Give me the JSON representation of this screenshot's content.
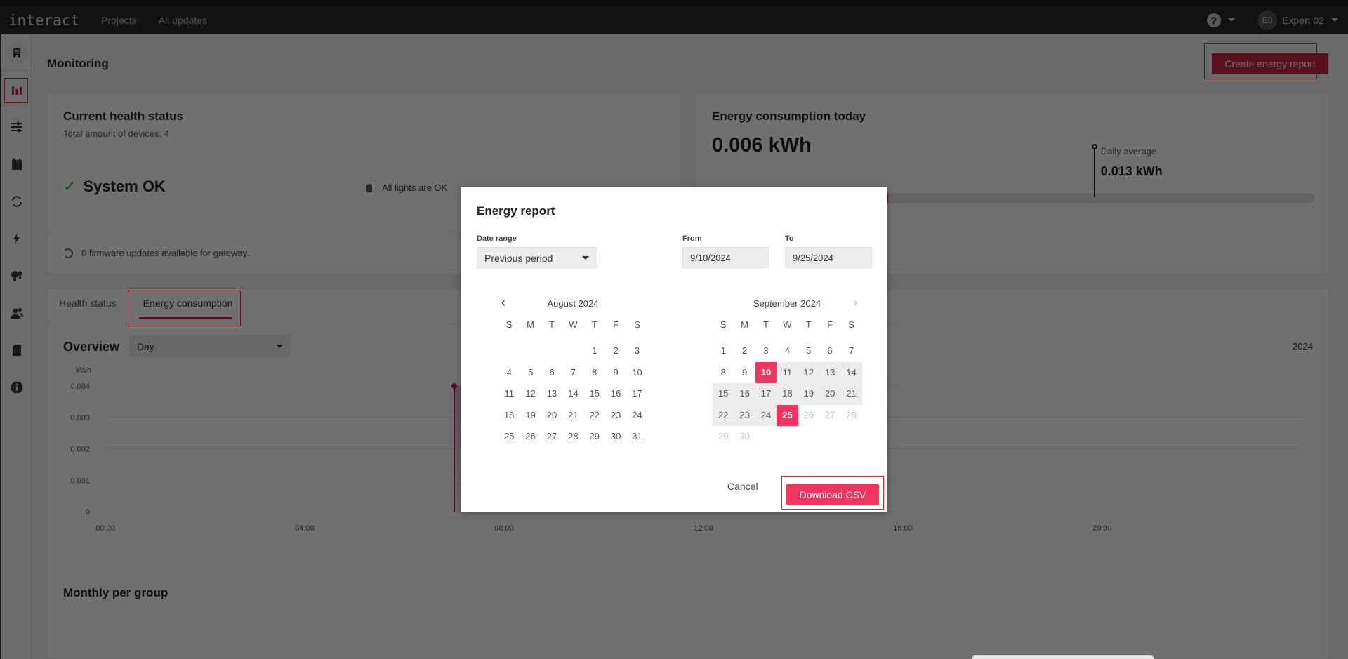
{
  "topbar": {
    "logo": "interact",
    "nav": [
      "Projects",
      "All updates"
    ],
    "help_icon": "?",
    "user_initials": "E0",
    "user_name": "Expert 02"
  },
  "sidebar": {
    "items": [
      {
        "icon": "building-icon",
        "active": false
      },
      {
        "icon": "bar-chart-icon",
        "active": true
      },
      {
        "icon": "sliders-icon",
        "active": false
      },
      {
        "icon": "calendar-icon",
        "active": false
      },
      {
        "icon": "sync-icon",
        "active": false
      },
      {
        "icon": "lightning-icon",
        "active": false
      },
      {
        "icon": "bulbs-icon",
        "active": false
      },
      {
        "icon": "users-icon",
        "active": false
      },
      {
        "icon": "document-icon",
        "active": false
      },
      {
        "icon": "info-icon",
        "active": false
      }
    ]
  },
  "page": {
    "title": "Monitoring",
    "create_report_label": "Create energy report"
  },
  "health": {
    "title": "Current health status",
    "subtitle": "Total amount of devices: 4",
    "status": "System OK",
    "lights": "All lights are OK",
    "firmware": "0 firmware updates available for gateway."
  },
  "energy_today": {
    "title": "Energy consumption today",
    "value": "0.006 kWh",
    "avg_label": "Daily average",
    "avg_value": "0.013 kWh",
    "today_kwh": 0.006,
    "bar_max_kwh": 0.0205,
    "avg_kwh": 0.013
  },
  "tabs": {
    "items": [
      "Health status",
      "Energy consumption"
    ],
    "active": 1
  },
  "overview": {
    "title": "Overview",
    "period": "Day",
    "year": "2024"
  },
  "chart_data": {
    "type": "area",
    "title": "",
    "xlabel": "",
    "ylabel": "kWh",
    "x_ticks": [
      "00:00",
      "04:00",
      "08:00",
      "12:00",
      "16:00",
      "20:00"
    ],
    "y_ticks": [
      "0",
      "0.001",
      "0.002",
      "0.003",
      "0.004"
    ],
    "ylim": [
      0,
      0.004
    ],
    "xlim_hours": [
      0,
      24
    ],
    "series": [
      {
        "name": "Consumption",
        "color": "#b0287a",
        "points": [
          [
            7.0,
            0.004
          ],
          [
            11.0,
            0.004
          ]
        ]
      }
    ],
    "grid": true
  },
  "monthly": {
    "title": "Monthly per group"
  },
  "modal": {
    "title": "Energy report",
    "date_range_label": "Date range",
    "date_range_value": "Previous period",
    "from_label": "From",
    "from_value": "9/10/2024",
    "to_label": "To",
    "to_value": "9/25/2024",
    "weekdays": [
      "S",
      "M",
      "T",
      "W",
      "T",
      "F",
      "S"
    ],
    "calendars": [
      {
        "title": "August 2024",
        "start_offset": 4,
        "days": 31,
        "range_start": null,
        "range_end": null,
        "muted_from": null
      },
      {
        "title": "September 2024",
        "start_offset": 0,
        "days": 30,
        "range_start": 10,
        "range_end": 25,
        "muted_from": 26
      }
    ],
    "cancel_label": "Cancel",
    "download_label": "Download CSV",
    "accent_color": "#f0365f"
  }
}
